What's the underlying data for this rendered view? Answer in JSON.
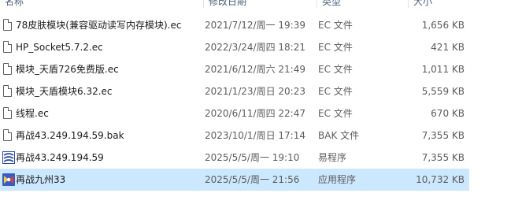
{
  "columns": {
    "name": "名称",
    "date": "修改日期",
    "type": "类型",
    "size": "大小"
  },
  "files": [
    {
      "name": "78皮肤模块(兼容驱动读写内存模块).ec",
      "date": "2021/7/12/周一 19:39",
      "type": "EC 文件",
      "size": "1,656 KB",
      "icon": "file-icon"
    },
    {
      "name": "HP_Socket5.7.2.ec",
      "date": "2022/3/24/周四 18:21",
      "type": "EC 文件",
      "size": "421 KB",
      "icon": "file-icon"
    },
    {
      "name": "模块_天盾726免费版.ec",
      "date": "2021/6/12/周六 21:49",
      "type": "EC 文件",
      "size": "1,011 KB",
      "icon": "file-icon"
    },
    {
      "name": "模块_天盾模块6.32.ec",
      "date": "2021/1/23/周日 20:23",
      "type": "EC 文件",
      "size": "5,559 KB",
      "icon": "file-icon"
    },
    {
      "name": "线程.ec",
      "date": "2020/6/11/周四 22:47",
      "type": "EC 文件",
      "size": "670 KB",
      "icon": "file-icon"
    },
    {
      "name": "再战43.249.194.59.bak",
      "date": "2023/10/1/周日 17:14",
      "type": "BAK 文件",
      "size": "7,355 KB",
      "icon": "file-icon"
    },
    {
      "name": "再战43.249.194.59",
      "date": "2025/5/5/周一 19:10",
      "type": "易程序",
      "size": "7,355 KB",
      "icon": "e-program-icon"
    },
    {
      "name": "再战九州33",
      "date": "2025/5/5/周一 21:56",
      "type": "应用程序",
      "size": "10,732 KB",
      "icon": "application-icon",
      "selected": true
    }
  ],
  "colors": {
    "selection": "#cce8ff",
    "e_program_icon": "#2c4aa8",
    "application_icon": "#3a5bbf"
  }
}
